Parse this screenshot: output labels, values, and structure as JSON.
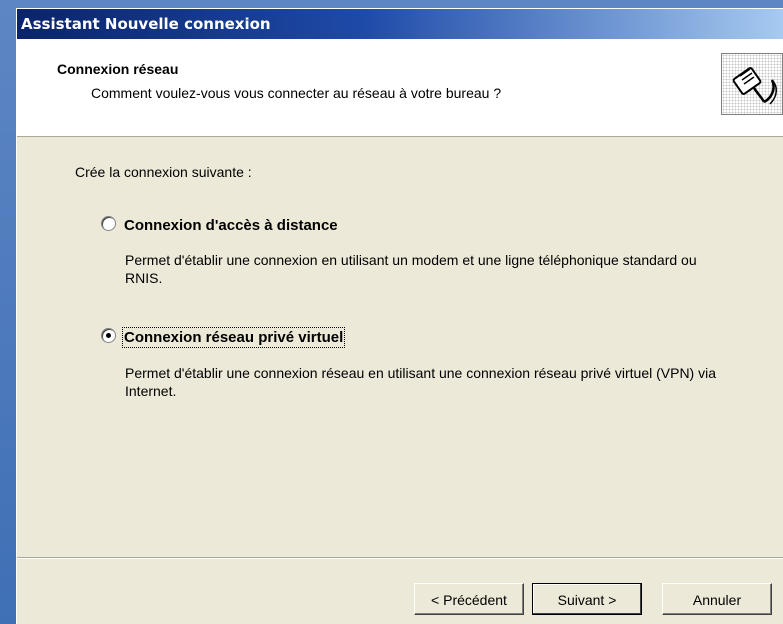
{
  "window": {
    "title": "Assistant Nouvelle connexion"
  },
  "header": {
    "title": "Connexion réseau",
    "subtitle": "Comment voulez-vous vous connecter au réseau à votre bureau ?",
    "icon": "network-cable-icon"
  },
  "body": {
    "intro": "Crée la connexion suivante :",
    "options": [
      {
        "label": "Connexion d'accès à distance",
        "description": "Permet d'établir une connexion en utilisant un modem et une ligne téléphonique standard ou RNIS.",
        "selected": false
      },
      {
        "label": "Connexion réseau privé virtuel",
        "description": "Permet d'établir une connexion réseau en utilisant une connexion réseau privé virtuel (VPN) via Internet.",
        "selected": true
      }
    ]
  },
  "buttons": {
    "previous": "< Précédent",
    "next": "Suivant >",
    "cancel": "Annuler"
  },
  "colors": {
    "titlebar_start": "#0a246a",
    "titlebar_end": "#a6caf0",
    "dialog_background": "#ece9d8"
  }
}
